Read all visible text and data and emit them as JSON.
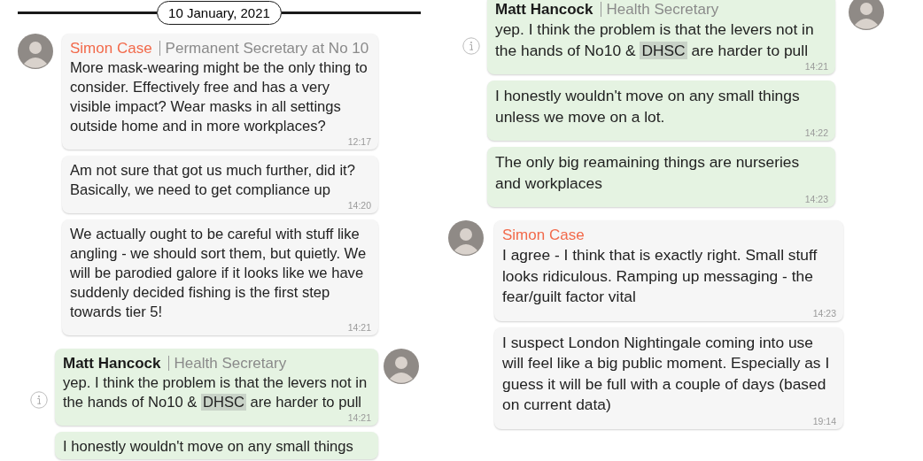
{
  "panels": [
    {
      "date": "10 January, 2021",
      "groups": [
        {
          "kind": "incoming",
          "sender": "Simon Case",
          "role": "Permanent Secretary at No 10",
          "color": "#f2694a",
          "messages": [
            {
              "parts": [
                {
                  "text": "More mask-wearing might be the only thing to consider. Effectively free and has a very visible impact? Wear masks in all settings outside home and in more workplaces?",
                  "highlighted": false
                }
              ],
              "time": "12:17"
            },
            {
              "parts": [
                {
                  "text": "Am not sure that got us much further, did it? Basically, we need to get compliance up",
                  "highlighted": false
                }
              ],
              "time": "14:20"
            },
            {
              "parts": [
                {
                  "text": "We actually ought to be careful with stuff like angling - we should sort them, but quietly. We will be parodied galore if it looks like we have suddenly decided fishing is the first step towards tier 5!",
                  "highlighted": false
                }
              ],
              "time": "14:21"
            }
          ]
        },
        {
          "kind": "outgoing",
          "sender": "Matt Hancock",
          "role": "Health Secretary",
          "color": "#1a1a1a",
          "messages": [
            {
              "parts": [
                {
                  "text": "yep. I think the problem is that the levers not in the hands of No10 & ",
                  "highlighted": false
                },
                {
                  "text": "DHSC",
                  "highlighted": true
                },
                {
                  "text": " are harder to pull",
                  "highlighted": false
                }
              ],
              "time": "14:21"
            },
            {
              "parts": [
                {
                  "text": "I honestly wouldn't move on any small things",
                  "highlighted": false
                }
              ]
            }
          ]
        }
      ]
    },
    {
      "groups": [
        {
          "kind": "outgoing",
          "sender": "Matt Hancock",
          "role": "Health Secretary",
          "color": "#1a1a1a",
          "messages": [
            {
              "parts": [
                {
                  "text": "yep. I think the problem is that the levers not in the hands of No10 & ",
                  "highlighted": false
                },
                {
                  "text": "DHSC",
                  "highlighted": true
                },
                {
                  "text": " are harder to pull",
                  "highlighted": false
                }
              ],
              "time": "14:21"
            },
            {
              "parts": [
                {
                  "text": "I honestly wouldn't move on any small things unless we move on a lot.",
                  "highlighted": false
                }
              ],
              "time": "14:22"
            },
            {
              "parts": [
                {
                  "text": "The only big reamaining things are nurseries and workplaces",
                  "highlighted": false
                }
              ],
              "time": "14:23"
            }
          ]
        },
        {
          "kind": "incoming",
          "sender": "Simon Case",
          "color": "#f2694a",
          "messages": [
            {
              "parts": [
                {
                  "text": "I agree - I think that is exactly right. Small stuff looks ridiculous. Ramping up messaging - the fear/guilt factor vital",
                  "highlighted": false
                }
              ],
              "time": "14:23"
            },
            {
              "parts": [
                {
                  "text": "I suspect London Nightingale coming into use will feel like a big public moment. Especially as I guess it will be full with a couple of days (based on current data)",
                  "highlighted": false
                }
              ],
              "time": "19:14"
            }
          ]
        }
      ]
    }
  ]
}
